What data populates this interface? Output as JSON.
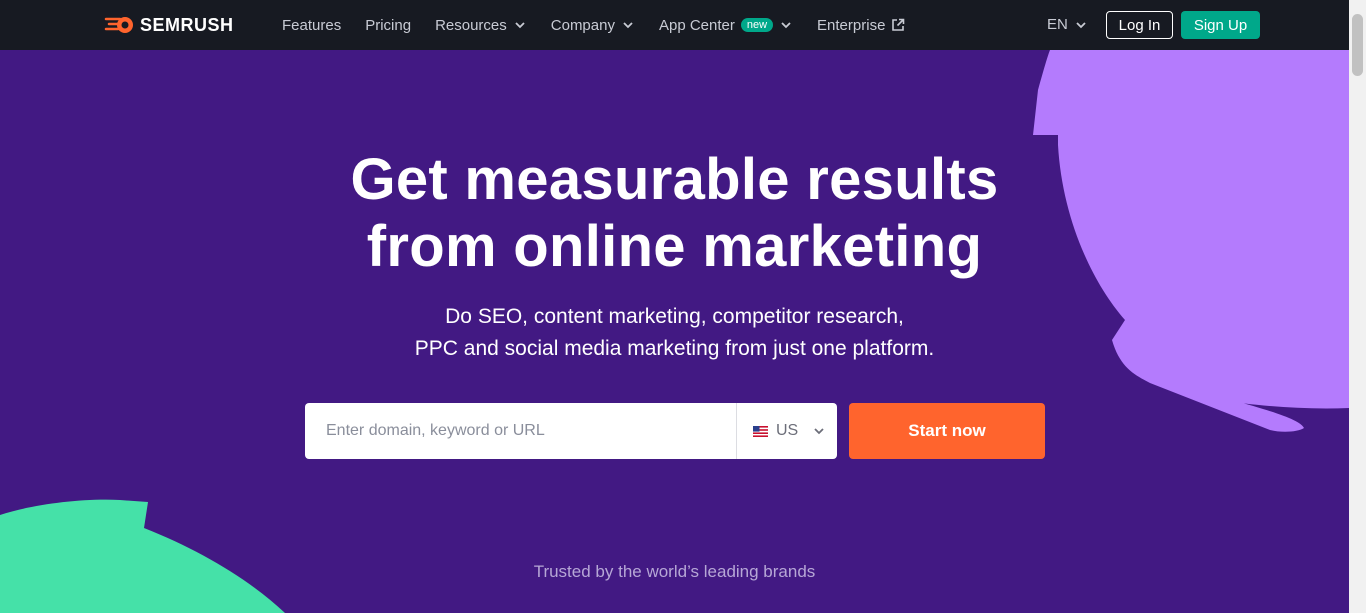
{
  "brand": {
    "name": "SEMRUSH"
  },
  "nav": {
    "items": [
      {
        "label": "Features"
      },
      {
        "label": "Pricing"
      },
      {
        "label": "Resources"
      },
      {
        "label": "Company"
      },
      {
        "label": "App Center",
        "badge": "new"
      },
      {
        "label": "Enterprise"
      }
    ],
    "language": "EN",
    "login_label": "Log In",
    "signup_label": "Sign Up"
  },
  "hero": {
    "title_line1": "Get measurable results",
    "title_line2": "from online marketing",
    "subtitle_line1": "Do SEO, content marketing, competitor research,",
    "subtitle_line2": "PPC and social media marketing from just one platform."
  },
  "search": {
    "placeholder": "Enter domain, keyword or URL",
    "value": "",
    "database": "US",
    "start_label": "Start now"
  },
  "trusted": {
    "text": "Trusted by the world’s leading brands"
  },
  "colors": {
    "hero_bg": "#421983",
    "nav_bg": "#171a22",
    "accent_orange": "#ff642d",
    "accent_green": "#00a88a",
    "decor_purple": "#b47bfd",
    "decor_mint": "#45e1a8"
  },
  "icons": {
    "logo": "semrush-fireball-icon",
    "dropdown": "chevron-down-icon",
    "external": "external-link-icon",
    "flag": "us-flag-icon"
  }
}
